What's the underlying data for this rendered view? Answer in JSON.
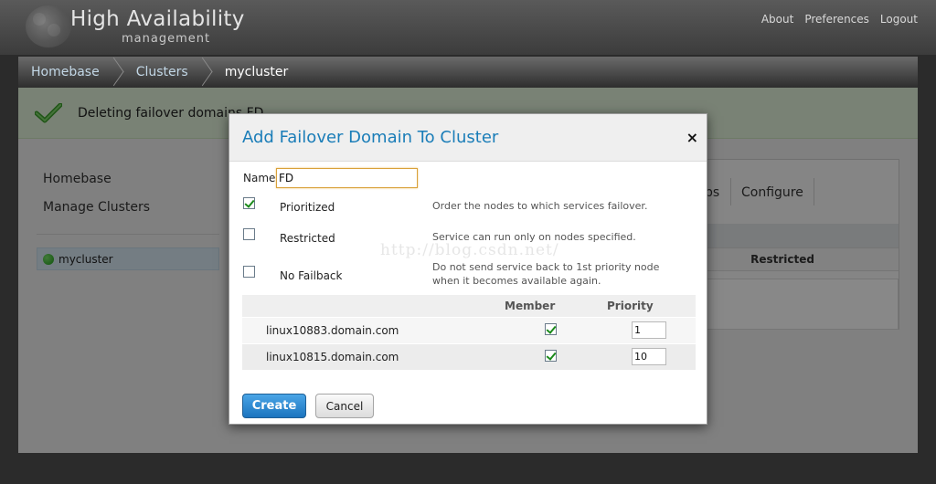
{
  "app": {
    "title": "High Availability",
    "subtitle": "management",
    "top_links": [
      "About",
      "Preferences",
      "Logout"
    ]
  },
  "breadcrumb": [
    "Homebase",
    "Clusters",
    "mycluster"
  ],
  "notice": {
    "text": "Deleting failover domains FD"
  },
  "sidebar": {
    "links": [
      "Homebase",
      "Manage Clusters"
    ],
    "cluster": "mycluster"
  },
  "background_panel": {
    "tabs": [
      "ps",
      "Configure"
    ],
    "header_restricted": "Restricted"
  },
  "watermark": "http://blog.csdn.net/",
  "modal": {
    "title": "Add Failover Domain To Cluster",
    "close_symbol": "×",
    "name_label": "Name",
    "name_value": "FD",
    "options": [
      {
        "label": "Prioritized",
        "checked": true,
        "description": "Order the nodes to which services failover."
      },
      {
        "label": "Restricted",
        "checked": false,
        "description": "Service can run only on nodes specified."
      },
      {
        "label": "No Failback",
        "checked": false,
        "description": "Do not send service back to 1st priority node when it becomes available again."
      }
    ],
    "table": {
      "columns": [
        "Member",
        "Priority"
      ],
      "rows": [
        {
          "node": "linux10883.domain.com",
          "member": true,
          "priority": "1"
        },
        {
          "node": "linux10815.domain.com",
          "member": true,
          "priority": "10"
        }
      ]
    },
    "create_label": "Create",
    "cancel_label": "Cancel"
  },
  "colors": {
    "accent": "#1a7db8",
    "notice_bg": "#dff0d8",
    "create_button": "#1b74bf",
    "status_green": "#1f9b1a"
  }
}
